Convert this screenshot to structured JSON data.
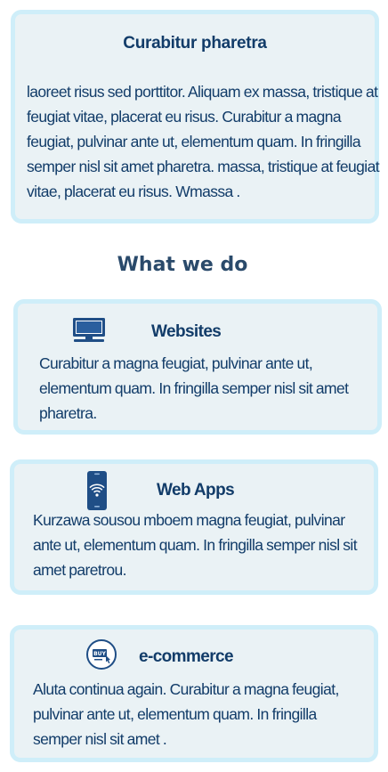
{
  "intro": {
    "title": "Curabitur pharetra",
    "text": "laoreet risus sed porttitor. Aliquam ex massa, tristique at feugiat vitae, placerat eu risus. Curabitur a magna feugiat, pulvinar ante ut, elementum quam. In fringilla semper nisl sit amet pharetra. massa, tristique at feugiat vitae, placerat eu risus. Wmassa ."
  },
  "section": {
    "heading": "What we do"
  },
  "services": [
    {
      "title": "Websites",
      "icon": "desktop-monitor-icon",
      "text": "Curabitur a magna feugiat, pulvinar ante ut, elementum quam. In fringilla semper nisl sit amet pharetra."
    },
    {
      "title": "Web Apps",
      "icon": "smartphone-wifi-icon",
      "text": " Kurzawa sousou mboem magna feugiat, pulvinar ante ut, elementum quam. In fringilla semper nisl sit amet paretrou."
    },
    {
      "title": "e-commerce",
      "icon": "buy-cart-icon",
      "text": "Aluta continua again. Curabitur a magna feugiat, pulvinar ante ut, elementum quam. In fringilla semper nisl sit amet ."
    }
  ],
  "colors": {
    "card_background": "#eaf2f5",
    "card_border": "#cfeef9",
    "text_primary": "#123c69",
    "icon_blue": "#1f4e86"
  }
}
